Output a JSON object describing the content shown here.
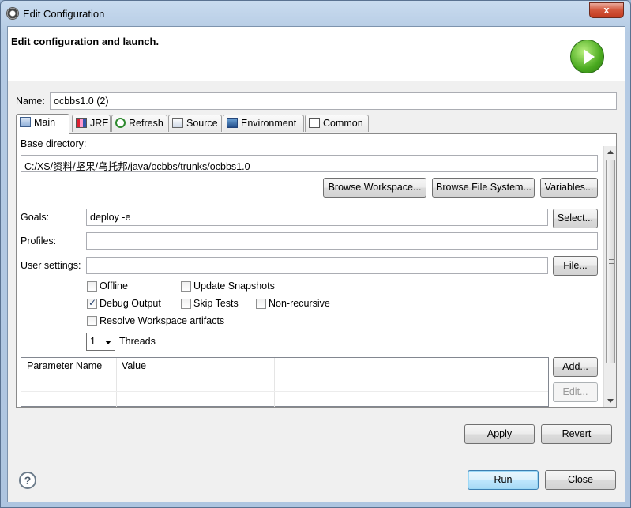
{
  "window": {
    "title": "Edit Configuration",
    "close_glyph": "x"
  },
  "header": {
    "title": "Edit configuration and launch.",
    "icon": "run-icon"
  },
  "name": {
    "label": "Name:",
    "value": "ocbbs1.0 (2)"
  },
  "tabs": [
    {
      "label": "Main",
      "icon": "main-icon",
      "active": true
    },
    {
      "label": "JRE",
      "icon": "jre-icon"
    },
    {
      "label": "Refresh",
      "icon": "refresh-icon"
    },
    {
      "label": "Source",
      "icon": "source-icon"
    },
    {
      "label": "Environment",
      "icon": "environment-icon"
    },
    {
      "label": "Common",
      "icon": "common-icon"
    }
  ],
  "main": {
    "base_dir_label": "Base directory:",
    "base_dir_value": "C:/XS/资料/坚果/乌托邦/java/ocbbs/trunks/ocbbs1.0",
    "browse_workspace": "Browse Workspace...",
    "browse_fs": "Browse File System...",
    "variables": "Variables...",
    "goals_label": "Goals:",
    "goals_value": "deploy -e",
    "select": "Select...",
    "profiles_label": "Profiles:",
    "profiles_value": "",
    "user_settings_label": "User settings:",
    "user_settings_value": "",
    "file": "File...",
    "offline": {
      "label": "Offline",
      "checked": false
    },
    "update_snapshots": {
      "label": "Update Snapshots",
      "checked": false
    },
    "debug_output": {
      "label": "Debug Output",
      "checked": true
    },
    "skip_tests": {
      "label": "Skip Tests",
      "checked": false
    },
    "non_recursive": {
      "label": "Non-recursive",
      "checked": false
    },
    "resolve_workspace": {
      "label": "Resolve Workspace artifacts",
      "checked": false
    },
    "threads_value": "1",
    "threads_label": "Threads",
    "table": {
      "columns": [
        "Parameter Name",
        "Value",
        ""
      ],
      "rows": []
    },
    "add": "Add...",
    "edit": "Edit..."
  },
  "footer": {
    "apply": "Apply",
    "revert": "Revert",
    "run": "Run",
    "close": "Close",
    "help_glyph": "?"
  }
}
